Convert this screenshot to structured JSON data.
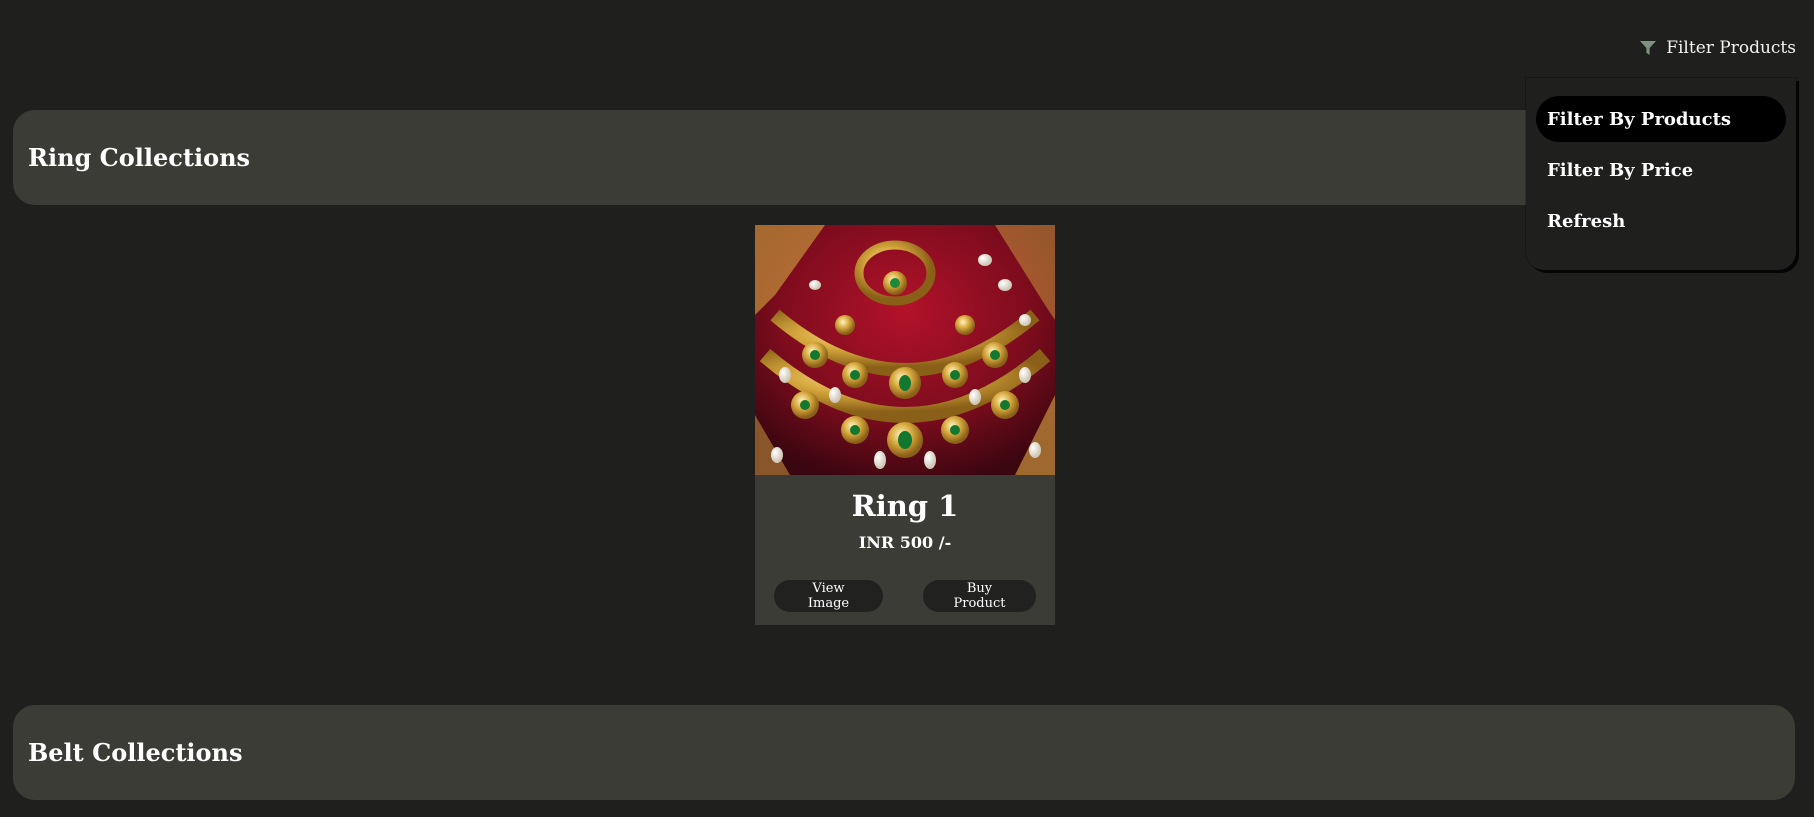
{
  "header": {
    "filter_label": "Filter Products",
    "filter_icon": "filter-icon"
  },
  "dropdown": {
    "items": [
      {
        "label": "Filter By Products",
        "active": true
      },
      {
        "label": "Filter By Price",
        "active": false
      },
      {
        "label": "Refresh",
        "active": false
      }
    ]
  },
  "sections": {
    "ring": {
      "title": "Ring Collections"
    },
    "belt": {
      "title": "Belt Collections"
    }
  },
  "products": [
    {
      "name": "Ring 1",
      "price": "INR 500 /-",
      "view_label": "View Image",
      "buy_label": "Buy Product"
    }
  ],
  "colors": {
    "background": "#1f201e",
    "panel": "#3c3c36",
    "filter_icon": "#7e9280",
    "active_item": "#000000"
  }
}
